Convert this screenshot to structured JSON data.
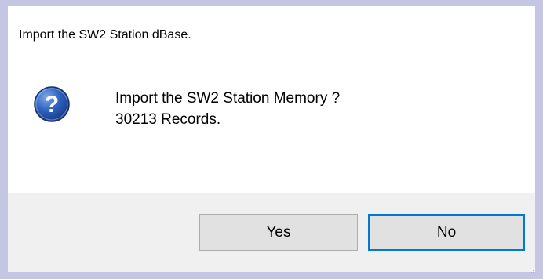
{
  "dialog": {
    "title": "Import the SW2 Station dBase.",
    "icon": "question-icon",
    "message_line1": "Import the SW2 Station Memory ?",
    "message_line2": "30213 Records.",
    "buttons": {
      "yes_label": "Yes",
      "no_label": "No"
    }
  },
  "colors": {
    "window_background": "#c4c6e4",
    "dialog_background": "#ffffff",
    "footer_background": "#f0f0f0",
    "button_face": "#e1e1e1",
    "default_button_border": "#0078d7",
    "question_icon_blue": "#2255a8"
  }
}
